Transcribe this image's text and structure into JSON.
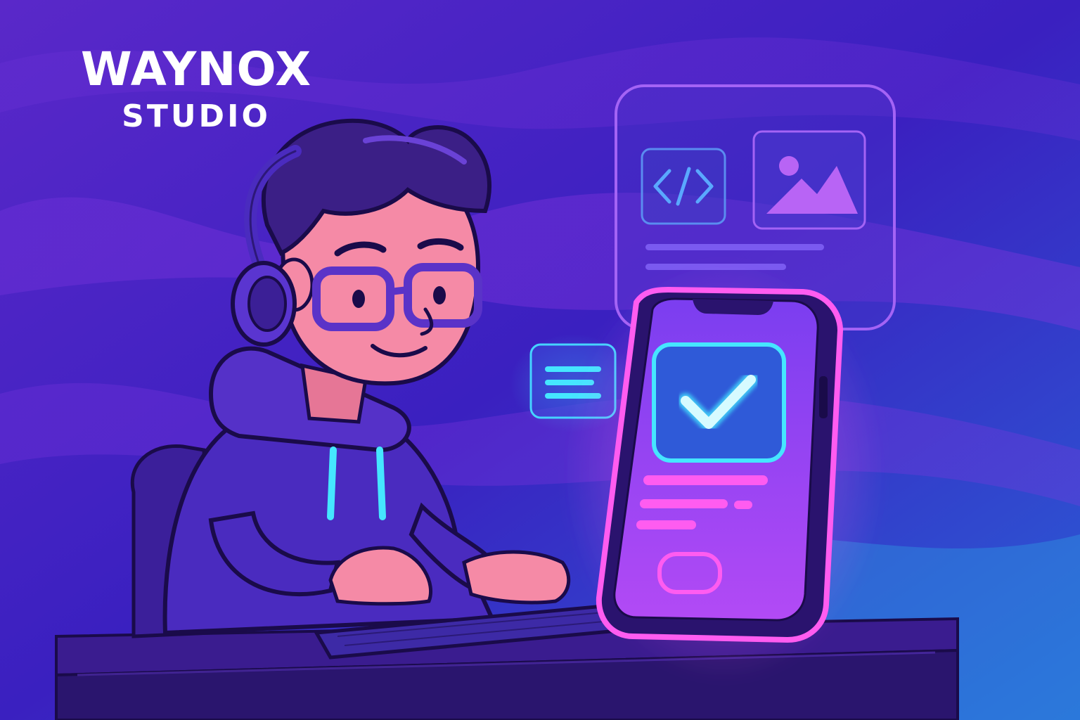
{
  "brand": {
    "title": "WAYNOX",
    "subtitle": "STUDIO"
  },
  "icons": {
    "code": "code-brackets-icon",
    "image": "image-mountain-icon",
    "check": "checkmark-icon",
    "text": "text-lines-icon"
  },
  "colors": {
    "background_top": "#4a24c8",
    "background_bottom": "#2b60d8",
    "neon_pink": "#ff5cf0",
    "neon_cyan": "#45e6ff",
    "skin": "#f58aa6",
    "hoodie": "#4a2bbf",
    "hair": "#3b1f86"
  }
}
